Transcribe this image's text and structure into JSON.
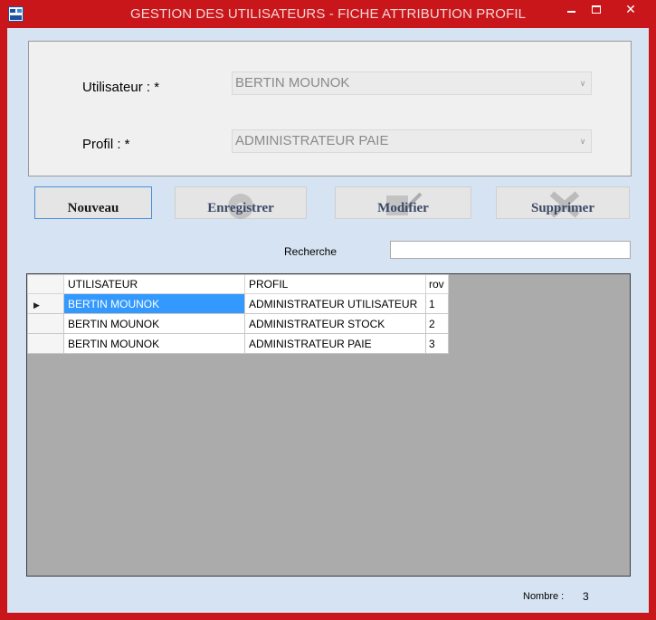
{
  "window": {
    "title": "GESTION DES UTILISATEURS - FICHE ATTRIBUTION PROFIL",
    "close_glyph": "✕"
  },
  "form": {
    "user_label": "Utilisateur : *",
    "user_value": "BERTIN MOUNOK",
    "profile_label": "Profil : *",
    "profile_value": "ADMINISTRATEUR PAIE"
  },
  "toolbar": {
    "new_label": "Nouveau",
    "save_label": "Enregistrer",
    "edit_label": "Modifier",
    "delete_label": "Supprimer"
  },
  "search": {
    "label": "Recherche",
    "value": ""
  },
  "grid": {
    "columns": [
      "UTILISATEUR",
      "PROFIL",
      "rov"
    ],
    "rows": [
      {
        "user": "BERTIN MOUNOK",
        "profile": "ADMINISTRATEUR UTILISATEUR",
        "row": "1"
      },
      {
        "user": "BERTIN MOUNOK",
        "profile": "ADMINISTRATEUR STOCK",
        "row": "2"
      },
      {
        "user": "BERTIN MOUNOK",
        "profile": "ADMINISTRATEUR PAIE",
        "row": "3"
      }
    ]
  },
  "footer": {
    "count_label": "Nombre :",
    "count_value": "3"
  },
  "colors": {
    "titlebar": "#c9161b",
    "client_bg": "#d6e3f2",
    "selection": "#3399ff"
  }
}
